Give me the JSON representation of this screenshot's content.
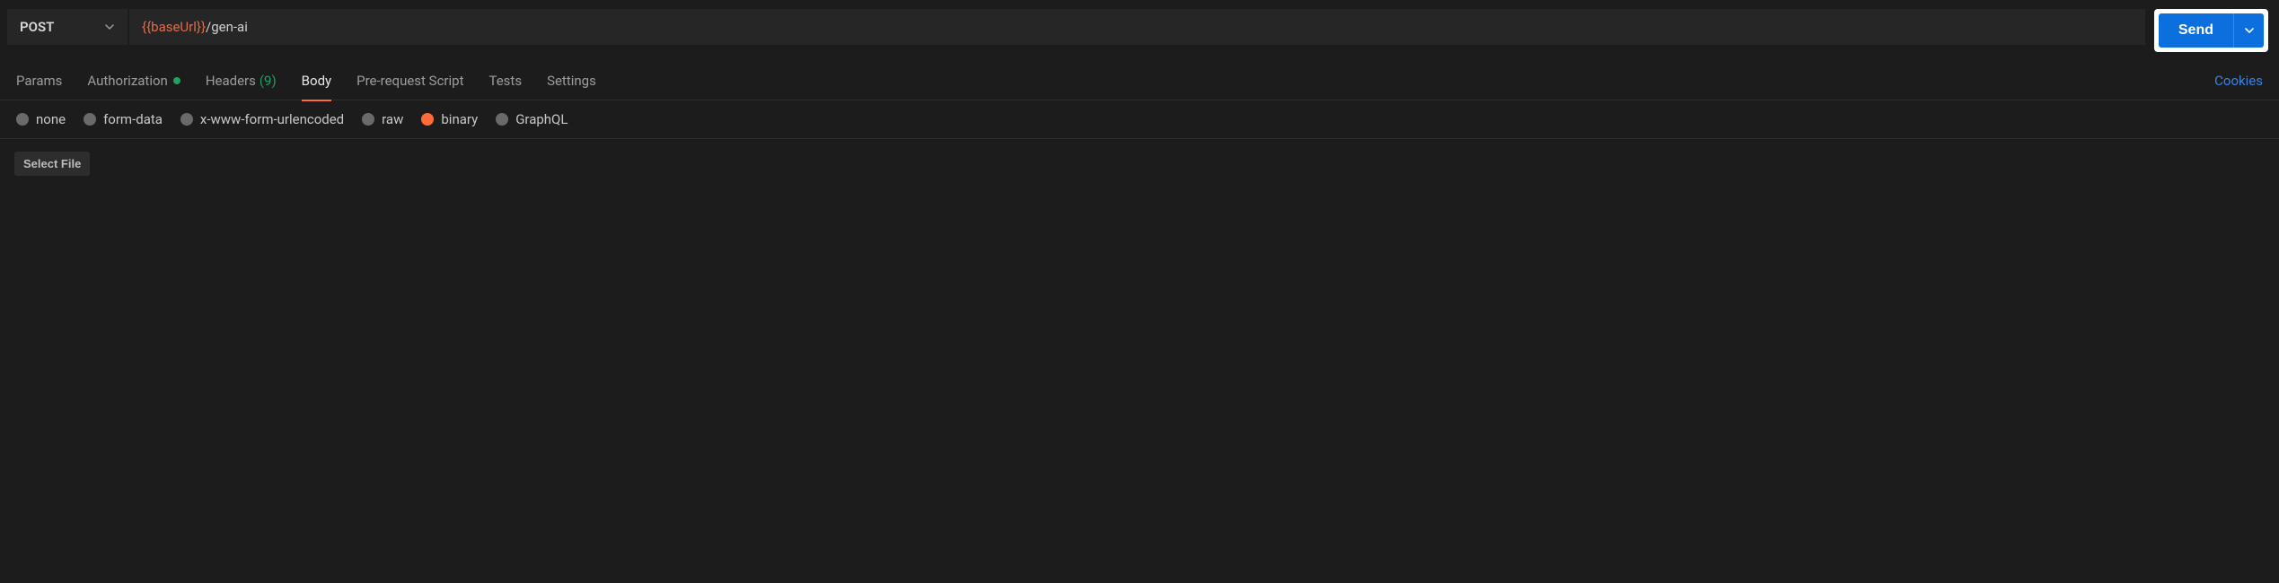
{
  "request": {
    "method": "POST",
    "url_variable": "{{baseUrl}}",
    "url_path": "/gen-ai",
    "send_label": "Send"
  },
  "tabs": {
    "params": "Params",
    "authorization": "Authorization",
    "headers_label": "Headers",
    "headers_count": "(9)",
    "body": "Body",
    "prerequest": "Pre-request Script",
    "tests": "Tests",
    "settings": "Settings",
    "cookies": "Cookies",
    "active": "Body"
  },
  "body_types": {
    "none": "none",
    "form_data": "form-data",
    "x_www": "x-www-form-urlencoded",
    "raw": "raw",
    "binary": "binary",
    "graphql": "GraphQL",
    "selected": "binary"
  },
  "body": {
    "select_file_label": "Select File"
  }
}
